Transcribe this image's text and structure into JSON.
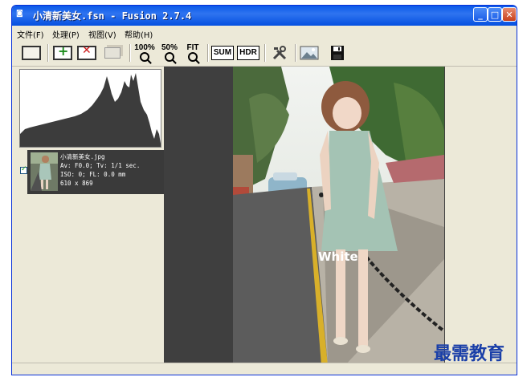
{
  "window": {
    "title": "小清新美女.fsn - Fusion 2.7.4",
    "minimize": "_",
    "maximize": "□",
    "close": "✕"
  },
  "menu": [
    "文件(F)",
    "处理(P)",
    "视图(V)",
    "帮助(H)"
  ],
  "toolbar": {
    "zoom_100": "100%",
    "zoom_50": "50%",
    "zoom_fit": "FIT",
    "sum": "SUM",
    "hdr": "HDR"
  },
  "thumbnail": {
    "filename": "小清新美女.jpg",
    "exposure": "Av: F0.0; Tv: 1/1 sec.",
    "iso": "ISO: 0; FL: 0.0 mm",
    "size": "610 x 869",
    "checked": true
  },
  "photo": {
    "caption": "White"
  },
  "watermark": "最需教育"
}
